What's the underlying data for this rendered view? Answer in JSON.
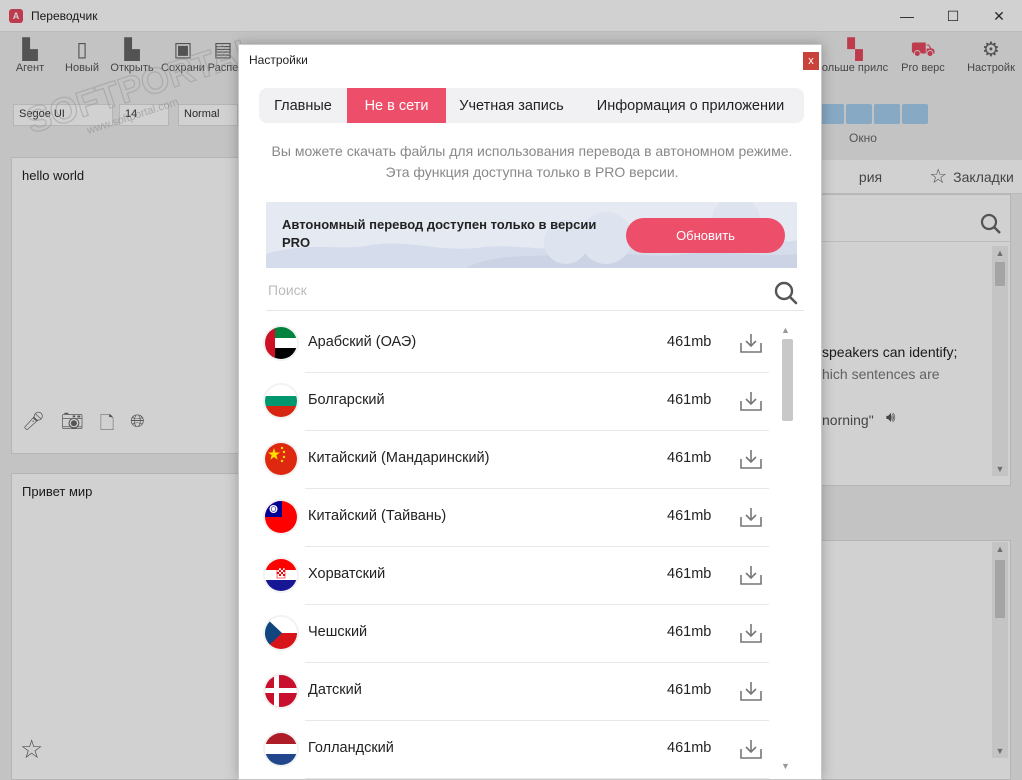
{
  "window": {
    "title": "Переводчик",
    "minimize": "—",
    "maximize": "☐",
    "close": "✕"
  },
  "toolbar": {
    "items": [
      {
        "label": "Агент",
        "icon": "folder-icon"
      },
      {
        "label": "Новый",
        "icon": "file-icon"
      },
      {
        "label": "Открыть",
        "icon": "open-folder-icon"
      },
      {
        "label": "Сохрани",
        "icon": "save-icon"
      },
      {
        "label": "Распе",
        "icon": "print-icon"
      }
    ],
    "right_items": [
      {
        "label": "ольше прилс",
        "icon": "apps-icon"
      },
      {
        "label": "Pro верс",
        "icon": "cart-icon"
      },
      {
        "label": "Настройк",
        "icon": "gear-icon"
      }
    ]
  },
  "format": {
    "font": "Segoe UI",
    "size": "14",
    "style": "Normal"
  },
  "view_group_label": "Окно",
  "source_text": "hello world",
  "target_text": "Привет мир",
  "right_panel": {
    "tab_history_fragment": "рия",
    "tab_bookmarks": "Закладки",
    "line1": "speakers can identify;",
    "line2": "hich sentences are",
    "line3": "norning\""
  },
  "watermark": {
    "brand": "SOFTPORTAL",
    "url": "www.softportal.com"
  },
  "dialog": {
    "title": "Настройки",
    "close_label": "x",
    "tabs": [
      {
        "label": "Главные",
        "active": false
      },
      {
        "label": "Не в сети",
        "active": true
      },
      {
        "label": "Учетная запись",
        "active": false
      },
      {
        "label": "Информация о приложении",
        "active": false
      }
    ],
    "description": "Вы можете скачать файлы для использования перевода в автономном режиме. Эта функция доступна только в PRO версии.",
    "banner_text": "Автономный перевод доступен только в версии PRO",
    "upgrade_button": "Обновить",
    "search_placeholder": "Поиск",
    "languages": [
      {
        "name": "Арабский (ОАЭ)",
        "size": "461mb",
        "flag": "uae"
      },
      {
        "name": "Болгарский",
        "size": "461mb",
        "flag": "bulgaria"
      },
      {
        "name": "Китайский (Мандаринский)",
        "size": "461mb",
        "flag": "china"
      },
      {
        "name": "Китайский (Тайвань)",
        "size": "461mb",
        "flag": "taiwan"
      },
      {
        "name": "Хорватский",
        "size": "461mb",
        "flag": "croatia"
      },
      {
        "name": "Чешский",
        "size": "461mb",
        "flag": "czech"
      },
      {
        "name": "Датский",
        "size": "461mb",
        "flag": "denmark"
      },
      {
        "name": "Голландский",
        "size": "461mb",
        "flag": "netherlands"
      }
    ]
  },
  "colors": {
    "accent": "#ED4F6A",
    "close_red": "#C8423A",
    "view_button_blue": "#A5CFEE"
  }
}
